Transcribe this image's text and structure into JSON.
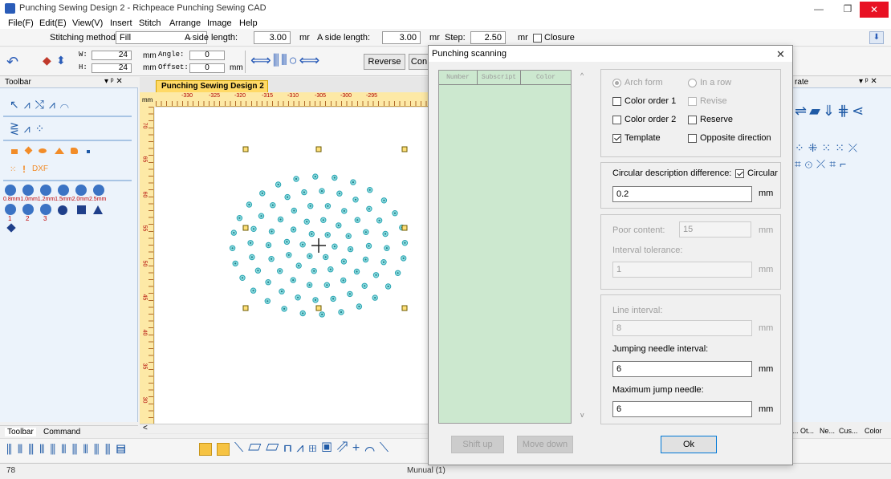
{
  "window": {
    "title": "Punching Sewing Design 2 - Richpeace Punching Sewing CAD",
    "controls": [
      "—",
      "❐",
      "✕"
    ]
  },
  "menu": [
    "File(F)",
    "Edit(E)",
    "View(V)",
    "Insert",
    "Stitch",
    "Arrange",
    "Image",
    "Help"
  ],
  "params": {
    "stitching_method_label": "Stitching method:",
    "stitching_method_value": "Fill",
    "aside_length_label_1": "A side length:",
    "aside_length_value_1": "3.00",
    "unit_1": "mr",
    "aside_length_label_2": "A side length:",
    "aside_length_value_2": "3.00",
    "unit_2": "mr",
    "step_label": "Step:",
    "step_value": "2.50",
    "unit_3": "mr",
    "closure_label": "Closure"
  },
  "toolrow": {
    "w_label": "W:",
    "w_value": "24",
    "h_label": "H:",
    "h_value": "24",
    "mm_1": "mm",
    "mm_2": "mm",
    "angle_label": "Angle:",
    "angle_value": "0",
    "offset_label": "Offset:",
    "offset_value": "0",
    "mm_3": "mm",
    "reverse_label": "Reverse",
    "con_label": "Con"
  },
  "left_panel": {
    "title": "Toolbar",
    "pin": "▾ ᵖ ✕",
    "dxf_label": "DXF",
    "sizes_label": "0.8mm1.0mm1.2mm1.5mm2.0mm2.5mm",
    "sub_labels": [
      "1",
      "2",
      "3"
    ]
  },
  "document": {
    "tab_label": "Punching Sewing Design 2",
    "tab_close": "x",
    "ruler_unit": "mm",
    "h_ticks": [
      "-330",
      "-325",
      "-320",
      "-315",
      "-310",
      "-305",
      "-300",
      "-295"
    ],
    "v_ticks": [
      "70",
      "65",
      "60",
      "55",
      "50",
      "45",
      "40",
      "35",
      "30"
    ]
  },
  "right_panel": {
    "title": "rate",
    "pin": "▾ ᵖ ✕",
    "tabs": [
      "... Ot...",
      "Ne...",
      "Cus...",
      "Color"
    ]
  },
  "bottom_tabs": [
    "Toolbar",
    "Command"
  ],
  "status": {
    "left": "78",
    "center": "Munual (1)"
  },
  "dialog": {
    "title": "Punching scanning",
    "close": "✕",
    "list_headers": [
      "Number",
      "Subscript",
      "Color"
    ],
    "options": {
      "arch_form": "Arch form",
      "in_a_row": "In a row",
      "color_order_1": "Color order 1",
      "revise": "Revise",
      "color_order_2": "Color order 2",
      "reserve": "Reserve",
      "template": "Template",
      "opposite_direction": "Opposite direction"
    },
    "circular_label": "Circular description difference:",
    "circular_check_label": "Circular",
    "circular_value": "0.2",
    "poor_content_label": "Poor content:",
    "poor_content_value": "15",
    "interval_tolerance_label": "Interval tolerance:",
    "interval_tolerance_value": "1",
    "line_interval_label": "Line interval:",
    "line_interval_value": "8",
    "jumping_label": "Jumping needle interval:",
    "jumping_value": "6",
    "max_jump_label": "Maximum jump needle:",
    "max_jump_value": "6",
    "unit": "mm",
    "shift_up": "Shift up",
    "move_down": "Move down",
    "ok": "Ok"
  }
}
